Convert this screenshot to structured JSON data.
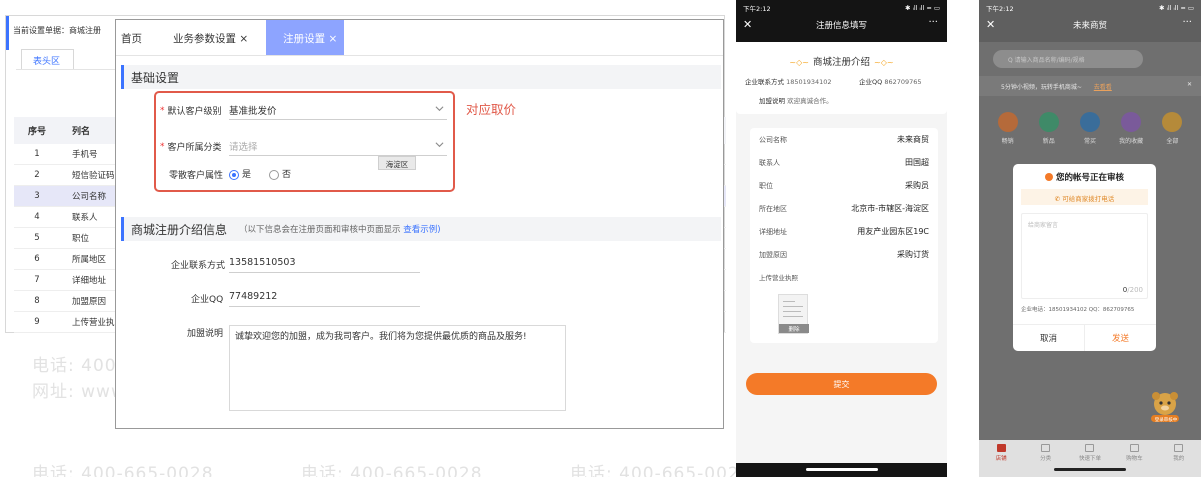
{
  "watermark": {
    "phone_line": "电话: 400-665-0028",
    "site_line": "网址: www.chanjet.net"
  },
  "back_panel": {
    "title": "当前设置单据：商城注册",
    "tab": "表头区",
    "columns": [
      "序号",
      "列名"
    ],
    "rows": [
      {
        "no": "1",
        "name": "手机号"
      },
      {
        "no": "2",
        "name": "短信验证码"
      },
      {
        "no": "3",
        "name": "公司名称"
      },
      {
        "no": "4",
        "name": "联系人"
      },
      {
        "no": "5",
        "name": "职位"
      },
      {
        "no": "6",
        "name": "所属地区"
      },
      {
        "no": "7",
        "name": "详细地址"
      },
      {
        "no": "8",
        "name": "加盟原因"
      },
      {
        "no": "9",
        "name": "上传营业执照"
      }
    ]
  },
  "main_panel": {
    "tabs": [
      {
        "label": "首页"
      },
      {
        "label": "业务参数设置 ×"
      },
      {
        "label": "注册设置 ×"
      }
    ],
    "section_basic": "基础设置",
    "default_level_label": "默认客户级别",
    "default_level_value": "基准批发价",
    "category_label": "客户所属分类",
    "category_placeholder": "请选择",
    "tooltip": "海淀区",
    "retail_label": "零散客户属性",
    "retail_yes": "是",
    "retail_no": "否",
    "annotation": "对应取价",
    "section_intro": "商城注册介绍信息",
    "intro_hint": "（以下信息会在注册页面和审核中页面显示",
    "intro_link": "查看示例)",
    "contact_label": "企业联系方式",
    "contact_value": "13581510503",
    "qq_label": "企业QQ",
    "qq_value": "77489212",
    "join_label": "加盟说明",
    "join_value": "诚挚欢迎您的加盟，成为我司客户。我们将为您提供最优质的商品及服务!"
  },
  "phone1": {
    "time": "下午2:12",
    "signal": "✱ ᵢll ᵢll ≈ ▭",
    "nav_title": "注册信息填写",
    "close": "✕",
    "more": "···",
    "intro_title": "商城注册介绍",
    "contact_label": "企业联系方式",
    "contact_value": "18501934102",
    "qq_label": "企业QQ",
    "qq_value": "862709765",
    "join_label": "加盟说明",
    "join_value": "欢迎真诚合作。",
    "fields": [
      {
        "label": "公司名称",
        "value": "未来商贸"
      },
      {
        "label": "联系人",
        "value": "田国超"
      },
      {
        "label": "职位",
        "value": "采购员"
      },
      {
        "label": "所在地区",
        "value": "北京市-市辖区-海淀区"
      },
      {
        "label": "详细地址",
        "value": "用友产业园东区19C"
      },
      {
        "label": "加盟原因",
        "value": "采购订货"
      }
    ],
    "license_label": "上传营业执照",
    "license_delete": "删除",
    "submit": "提交"
  },
  "phone2": {
    "time": "下午2:12",
    "signal": "✱ ᵢll ᵢll ≈ ▭",
    "nav_title": "未来商贸",
    "close": "✕",
    "more": "···",
    "search_placeholder": "Q 请输入商品名称/编码/规格",
    "banner_text": "5分钟小视频，玩转手机商城~",
    "banner_link": "去看看",
    "banner_close": "✕",
    "icons": [
      "畅销",
      "新品",
      "常买",
      "我的收藏",
      "全部"
    ],
    "modal_title": "您的帐号正在审核",
    "modal_call": "可给商家拨打电话",
    "modal_placeholder": "给商家留言",
    "modal_count": "0",
    "modal_max": "/200",
    "modal_info": "企业电话：18501934102   QQ：862709765",
    "modal_cancel": "取消",
    "modal_send": "发送",
    "mascot_label": "登录审核中",
    "tabs": [
      "店铺",
      "分类",
      "快速下单",
      "购物车",
      "我的"
    ]
  }
}
